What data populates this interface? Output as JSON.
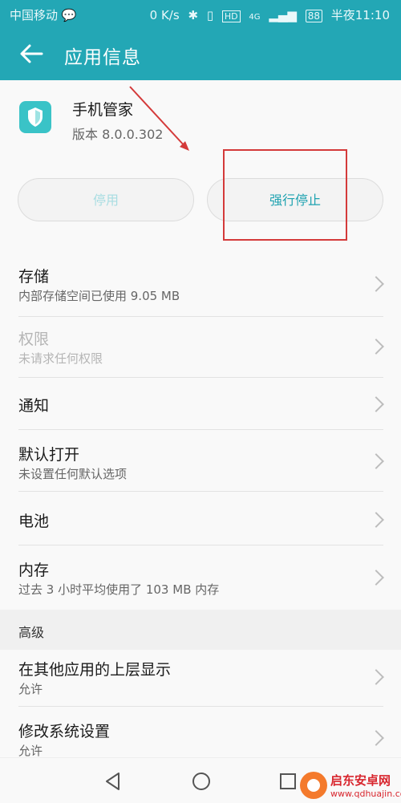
{
  "status_bar": {
    "carrier": "中国移动",
    "speed": "0 K/s",
    "network": "4G",
    "battery": "88",
    "time": "半夜11:10"
  },
  "app_bar": {
    "title": "应用信息",
    "back_icon": "arrow-left-icon"
  },
  "app": {
    "name": "手机管家",
    "version": "版本 8.0.0.302",
    "icon": "shield-icon"
  },
  "buttons": {
    "disable": "停用",
    "force_stop": "强行停止"
  },
  "settings": [
    {
      "title": "存储",
      "subtitle": "内部存储空间已使用 9.05 MB"
    },
    {
      "title": "权限",
      "subtitle": "未请求任何权限"
    },
    {
      "title": "通知",
      "subtitle": ""
    },
    {
      "title": "默认打开",
      "subtitle": "未设置任何默认选项"
    },
    {
      "title": "电池",
      "subtitle": ""
    },
    {
      "title": "内存",
      "subtitle": "过去 3 小时平均使用了 103 MB 内存"
    }
  ],
  "advanced": {
    "header": "高级",
    "items": [
      {
        "title": "在其他应用的上层显示",
        "subtitle": "允许"
      },
      {
        "title": "修改系统设置",
        "subtitle": "允许"
      }
    ]
  },
  "watermark": {
    "name": "启东安卓网",
    "url": "www.qdhuajin.com"
  },
  "colors": {
    "accent": "#23a7b5",
    "highlight": "#d43a3a"
  }
}
